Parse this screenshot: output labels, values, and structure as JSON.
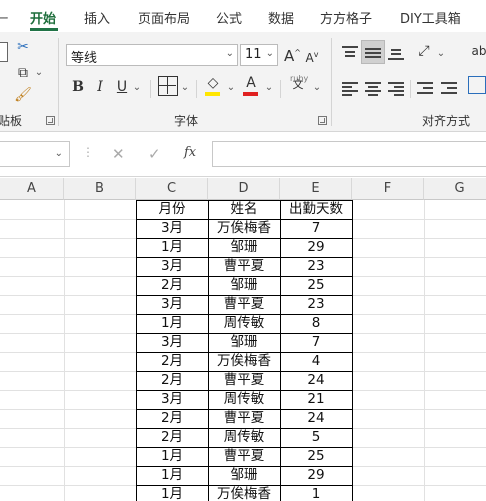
{
  "ribbon_tabs": [
    {
      "label": "开始",
      "active": true
    },
    {
      "label": "插入",
      "active": false
    },
    {
      "label": "页面布局",
      "active": false
    },
    {
      "label": "公式",
      "active": false
    },
    {
      "label": "数据",
      "active": false
    },
    {
      "label": "方方格子",
      "active": false
    },
    {
      "label": "DIY工具箱",
      "active": false
    }
  ],
  "ribbon": {
    "font_name": "等线",
    "font_size": "11",
    "groups": {
      "clipboard": "贴板",
      "font": "字体",
      "alignment": "对齐方式"
    },
    "bold_label": "B",
    "italic_label": "I",
    "underline_label": "U",
    "font_color_label": "A",
    "grow_font_label": "A",
    "shrink_font_label": "A",
    "wen_label": "文",
    "fill_color": "#ffe600",
    "font_color": "#e02020"
  },
  "formula_bar": {
    "fx_label": "fx",
    "cancel_label": "✕",
    "enter_label": "✓",
    "dots_label": "⋮"
  },
  "columns": [
    "A",
    "B",
    "C",
    "D",
    "E",
    "F",
    "G"
  ],
  "table": {
    "headers": [
      "月份",
      "姓名",
      "出勤天数"
    ],
    "rows": [
      [
        "3月",
        "万俟梅香",
        "7"
      ],
      [
        "1月",
        "邹珊",
        "29"
      ],
      [
        "3月",
        "曹平夏",
        "23"
      ],
      [
        "2月",
        "邹珊",
        "25"
      ],
      [
        "3月",
        "曹平夏",
        "23"
      ],
      [
        "1月",
        "周传敏",
        "8"
      ],
      [
        "3月",
        "邹珊",
        "7"
      ],
      [
        "2月",
        "万俟梅香",
        "4"
      ],
      [
        "2月",
        "曹平夏",
        "24"
      ],
      [
        "3月",
        "周传敏",
        "21"
      ],
      [
        "2月",
        "曹平夏",
        "24"
      ],
      [
        "2月",
        "周传敏",
        "5"
      ],
      [
        "1月",
        "曹平夏",
        "25"
      ],
      [
        "1月",
        "邹珊",
        "29"
      ],
      [
        "1月",
        "万俟梅香",
        "1"
      ]
    ]
  }
}
